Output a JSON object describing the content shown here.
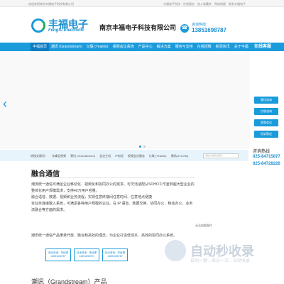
{
  "topbar": {
    "welcome": "欢迎来到南京丰福电子科技有限公司",
    "links": [
      "丰福电子科技",
      "在线留言",
      "加入收藏夹",
      "网站地图",
      "联系丰福电子"
    ]
  },
  "header": {
    "logo_text": "丰福电子",
    "logo_sub": "Fengfu Electronic",
    "company": "南京丰福电子科技有限公司",
    "hotline_label": "咨询热线：",
    "hotline_number": "13851698787"
  },
  "nav": {
    "items": [
      "丰福首页",
      "潮讯 (Grandstream)",
      "亿联 (Yealink)",
      "视频会议系统",
      "产品中心",
      "解决方案",
      "服务与支持",
      "在线招聘",
      "新闻资讯",
      "关于丰福"
    ]
  },
  "banner": {
    "prev_icon": "chevron-left-icon"
  },
  "side": {
    "title": "在线客服",
    "buttons": [
      "潮讯咨询",
      "亿联咨询",
      "视频会议",
      "投诉建议"
    ],
    "phone_title": "咨询热线",
    "phones": [
      "025-84715877",
      "025-84728226"
    ]
  },
  "prodbar": {
    "items": [
      "热搜关键词：",
      "东峰云视频",
      "潮讯 (Grandstream)",
      "会议主机",
      "IP电话",
      "视频会议服务",
      "亿联 (Yealink)",
      "潮讯(ATCOM)"
    ],
    "search_placeholder": "请输入搜索关键词"
  },
  "section": {
    "title": "融合通信",
    "p1": "潮流统一通信可满足企业移动化、视频化和协同办公的需求。可灵活适配从SOHO工作室到超大型企业的整体化用户规模需求，支持40万用户容量。",
    "p2": "融合语音、数据、视频和业务流程，实现任意终端间任意时间、任意地点便捷",
    "p3": "全业务连接融入系统，可满足各种用户规模的企业。在 IP 语音、数据交换、协同办公、移动办公、业务流融合等方面的需求。",
    "p4": "潮讯统一通信产品秉承开放、融合和高效的理念，为企业打造低成本、高效的协同办公系统。",
    "contacts": [
      {
        "role": "商务咨询：",
        "name": "李经理",
        "phone": "13851698787"
      },
      {
        "role": "技术咨询：",
        "name": "李经理",
        "phone": "13851698787"
      },
      {
        "role": "技术咨询：",
        "name": "李经理",
        "phone": "13851698787"
      }
    ]
  },
  "image": {
    "placeholder": "无法加载图片"
  },
  "watermark": {
    "title": "自动秒收录",
    "sub": "自动一键→来访一次→自动收录"
  },
  "bottom": {
    "title": "潮讯（Grandstream）产品"
  }
}
